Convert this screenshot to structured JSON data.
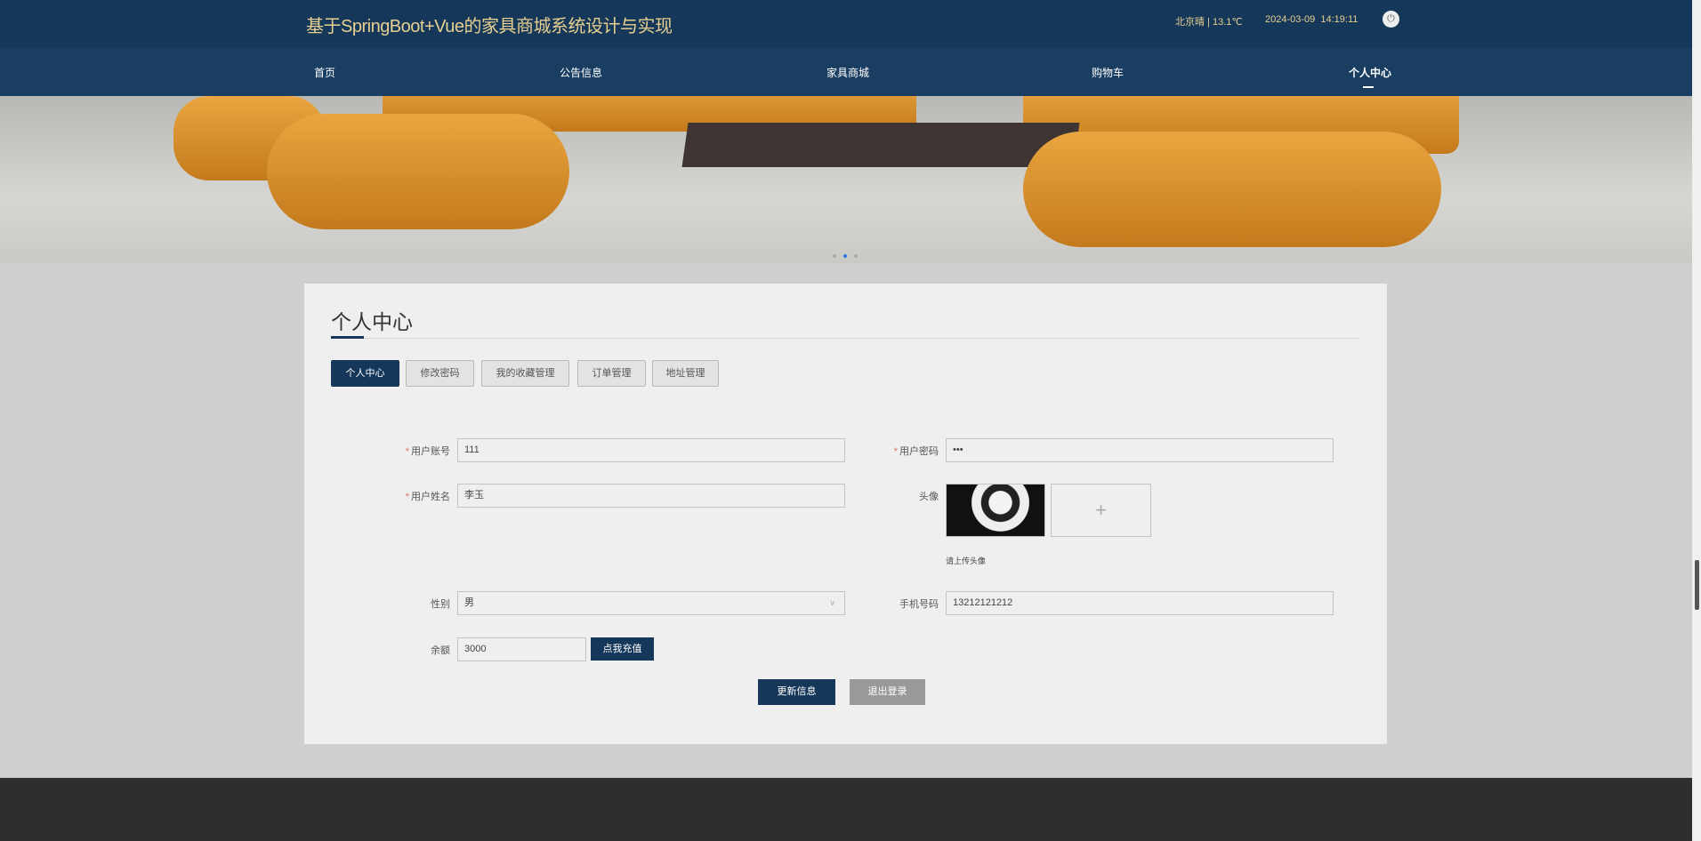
{
  "header": {
    "title": "基于SpringBoot+Vue的家具商城系统设计与实现",
    "weather": "北京晴 | 13.1℃",
    "datetime": "2024-03-09  14:19:11",
    "power_icon": "power-icon"
  },
  "nav": [
    "首页",
    "公告信息",
    "家具商城",
    "购物车",
    "个人中心"
  ],
  "page": {
    "heading": "个人中心",
    "tabs": [
      "个人中心",
      "修改密码",
      "我的收藏管理",
      "订单管理",
      "地址管理"
    ],
    "form": {
      "account_label": "用户账号",
      "account": "111",
      "password_label": "用户密码",
      "password": "•••",
      "name_label": "用户姓名",
      "name": "李玉",
      "avatar_label": "头像",
      "avatar_hint": "请上传头像",
      "upload_plus": "+",
      "gender_label": "性别",
      "gender": "男",
      "phone_label": "手机号码",
      "phone": "13212121212",
      "balance_label": "余额",
      "balance": "3000",
      "recharge": "点我充值",
      "required_mark": "*"
    },
    "update_button": "更新信息",
    "logout_button": "退出登录"
  },
  "colors": {
    "primary": "#15375a",
    "title": "#e6cf8f"
  }
}
